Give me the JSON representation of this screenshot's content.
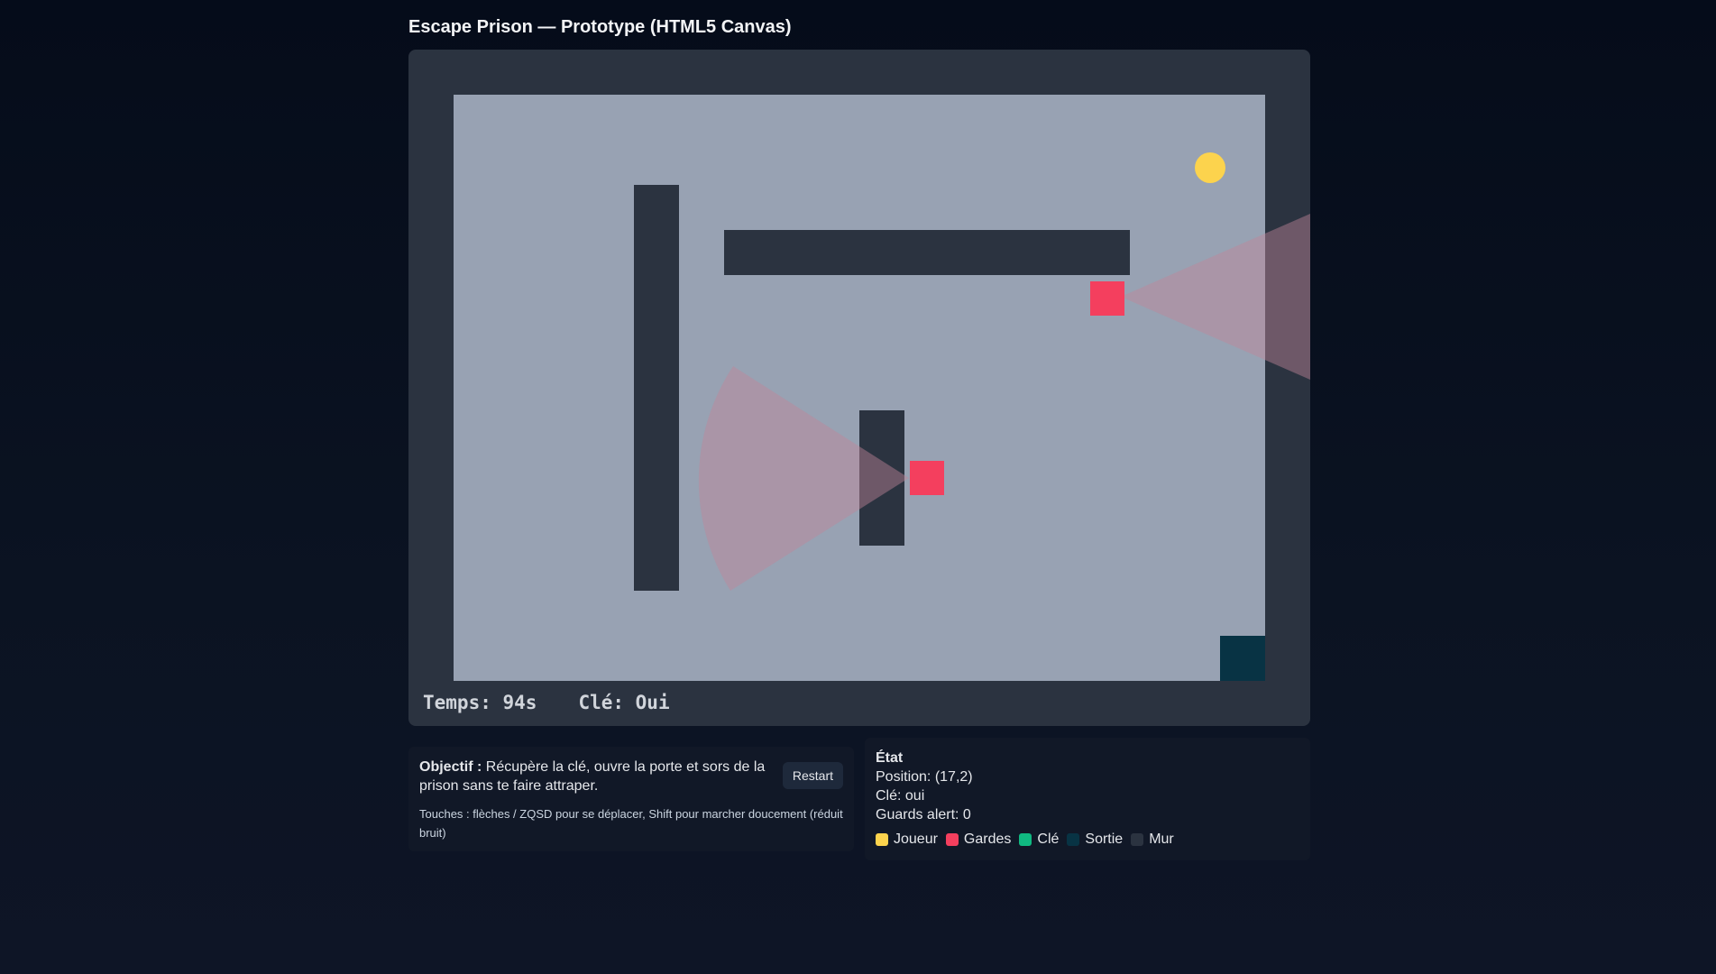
{
  "page": {
    "title": "Escape Prison — Prototype (HTML5 Canvas)"
  },
  "hud": {
    "time_text": "Temps: 94s",
    "key_text": "Clé: Oui"
  },
  "objective": {
    "label": "Objectif :",
    "text": "Récupère la clé, ouvre la porte et sors de la prison sans te faire attraper.",
    "controls": "Touches : flèches / ZQSD pour se déplacer, Shift pour marcher doucement (réduit bruit)",
    "restart_label": "Restart"
  },
  "status": {
    "heading": "État",
    "position": "Position: (17,2)",
    "key": "Clé: oui",
    "guards_alert": "Guards alert: 0"
  },
  "legend": [
    {
      "label": "Joueur",
      "color": "#fcd34d",
      "icon": "player-swatch"
    },
    {
      "label": "Gardes",
      "color": "#f43f5e",
      "icon": "guard-swatch"
    },
    {
      "label": "Clé",
      "color": "#10b981",
      "icon": "key-swatch"
    },
    {
      "label": "Sortie",
      "color": "#083344",
      "icon": "exit-swatch"
    },
    {
      "label": "Mur",
      "color": "#2b3340",
      "icon": "wall-swatch"
    }
  ],
  "colors": {
    "floor": "#98a2b3",
    "wall": "#2b3340",
    "player": "#fcd34d",
    "guard": "#f43f5e",
    "exit": "#083344",
    "vision_cone": "#c0849a"
  }
}
